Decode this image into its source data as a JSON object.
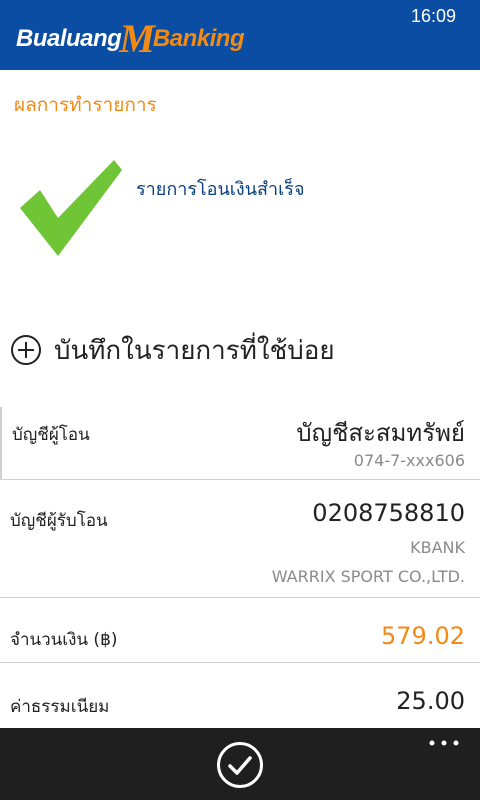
{
  "app": {
    "logo_left": "Bualuang",
    "logo_m": "M",
    "logo_right": "Banking"
  },
  "status": {
    "time": "16:09"
  },
  "result": {
    "section_title": "ผลการทำรายการ",
    "success_message": "รายการโอนเงินสำเร็จ"
  },
  "favorite": {
    "label": "บันทึกในรายการที่ใช้บ่อย"
  },
  "details": {
    "from": {
      "label": "บัญชีผู้โอน",
      "account_name": "บัญชีสะสมทรัพย์",
      "account_no": "074-7-xxx606"
    },
    "to": {
      "label": "บัญชีผู้รับโอน",
      "account_no": "0208758810",
      "bank": "KBANK",
      "name": "WARRIX SPORT CO.,LTD."
    },
    "amount": {
      "label": "จำนวนเงิน (฿)",
      "value": "579.02"
    },
    "fee": {
      "label": "ค่าธรรมเนียม",
      "value": "25.00"
    }
  },
  "colors": {
    "brand_blue": "#0a4da2",
    "accent_orange": "#f28a14",
    "success_green": "#6fc536",
    "appbar": "#1f1f1f"
  },
  "icons": {
    "success": "checkmark-icon",
    "add": "plus-circle-icon",
    "confirm": "check-circle-icon",
    "more": "ellipsis-icon"
  }
}
